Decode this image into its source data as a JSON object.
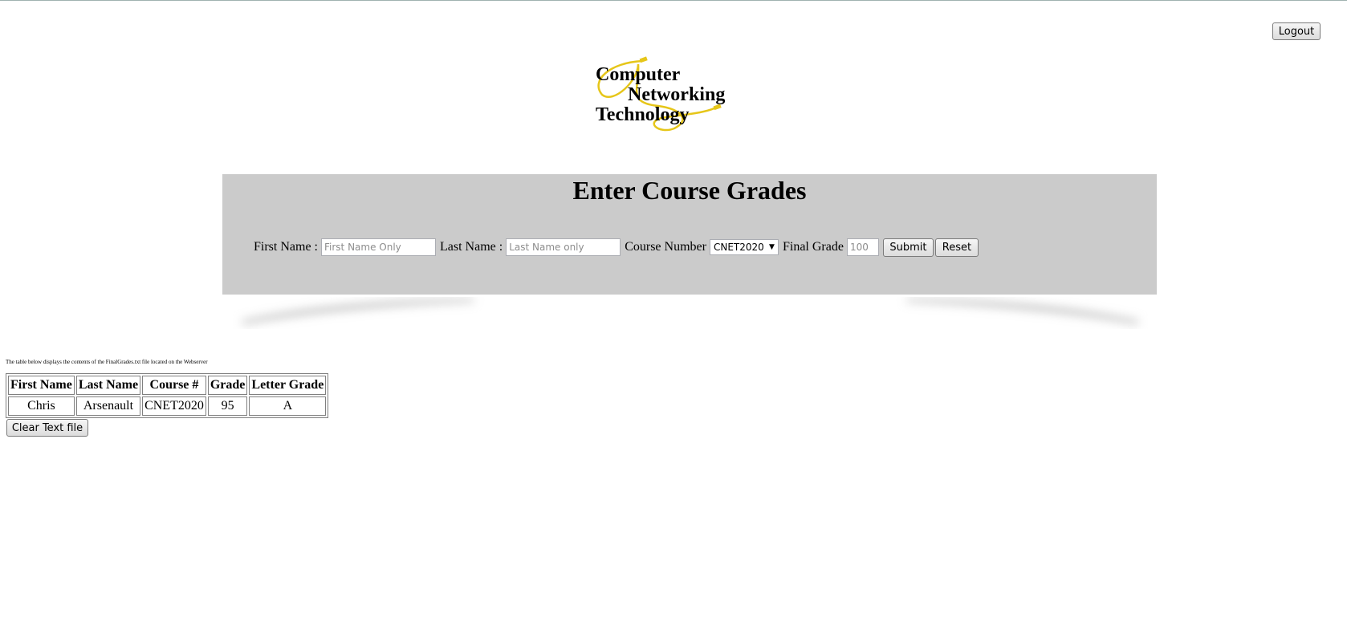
{
  "header": {
    "logout_label": "Logout",
    "logo_lines": [
      "Computer",
      "Networking",
      "Technology"
    ]
  },
  "form": {
    "title": "Enter Course Grades",
    "first_name_label": "First Name :",
    "first_name_placeholder": "First Name Only",
    "first_name_value": "",
    "last_name_label": "Last Name :",
    "last_name_placeholder": "Last Name only",
    "last_name_value": "",
    "course_label": "Course Number",
    "course_selected": "CNET2020",
    "grade_label": "Final Grade",
    "grade_placeholder": "100",
    "grade_value": "",
    "submit_label": "Submit",
    "reset_label": "Reset"
  },
  "results": {
    "note": "The table below displays the contents of the FinalGrades.txt file located on the Webserver",
    "columns": [
      "First Name",
      "Last Name",
      "Course #",
      "Grade",
      "Letter Grade"
    ],
    "rows": [
      [
        "Chris",
        "Arsenault",
        "CNET2020",
        "95",
        "A"
      ]
    ],
    "clear_label": "Clear Text file"
  },
  "colors": {
    "panel_bg": "#cbcbcb",
    "logo_cable": "#e6c619"
  }
}
